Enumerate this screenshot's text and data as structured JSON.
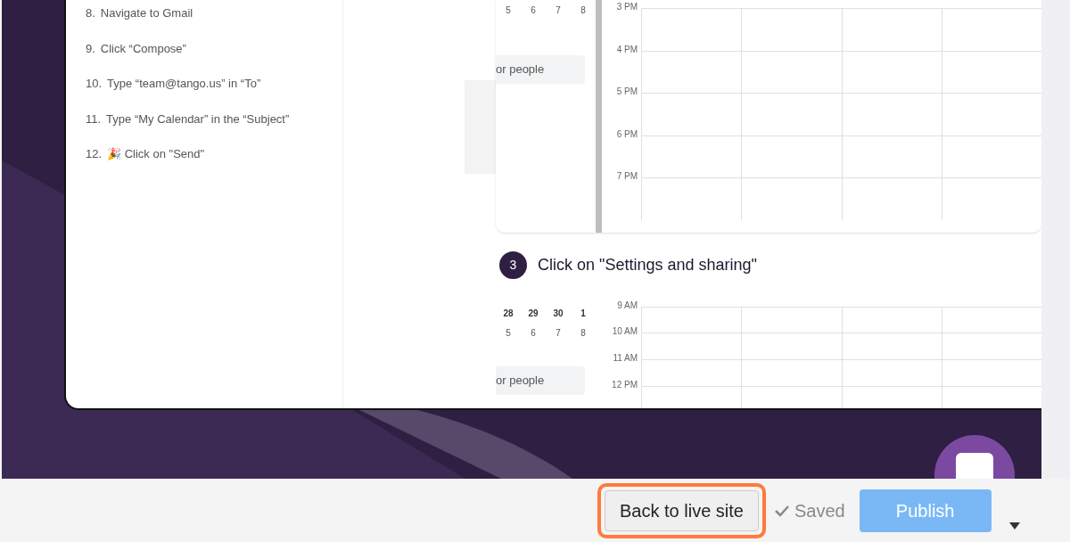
{
  "steps": [
    {
      "number": "8.",
      "text": "Navigate to Gmail"
    },
    {
      "number": "9.",
      "text": "Click “Compose”"
    },
    {
      "number": "10.",
      "text": "Type “team@tango.us” in “To”"
    },
    {
      "number": "11.",
      "text": "Type “My Calendar” in the “Subject”"
    },
    {
      "number": "12.",
      "text": "🎉 Click on \"Send\""
    }
  ],
  "screenshot_1": {
    "date_rows": [
      [
        "5",
        "6",
        "7",
        "8"
      ]
    ],
    "search_text": "or people",
    "times": [
      "3 PM",
      "4 PM",
      "5 PM",
      "6 PM",
      "7 PM"
    ]
  },
  "step_3": {
    "number": "3",
    "title": "Click on \"Settings and sharing\""
  },
  "screenshot_2": {
    "date_rows": [
      [
        "28",
        "29",
        "30",
        "1"
      ],
      [
        "5",
        "6",
        "7",
        "8"
      ]
    ],
    "search_text": "or people",
    "times": [
      "9 AM",
      "10 AM",
      "11 AM",
      "12 PM"
    ]
  },
  "footer": {
    "back_button": {
      "label": "Back to live site",
      "highlighted": true
    },
    "status": "Saved",
    "publish": {
      "label": "Publish",
      "disabled": true
    }
  }
}
